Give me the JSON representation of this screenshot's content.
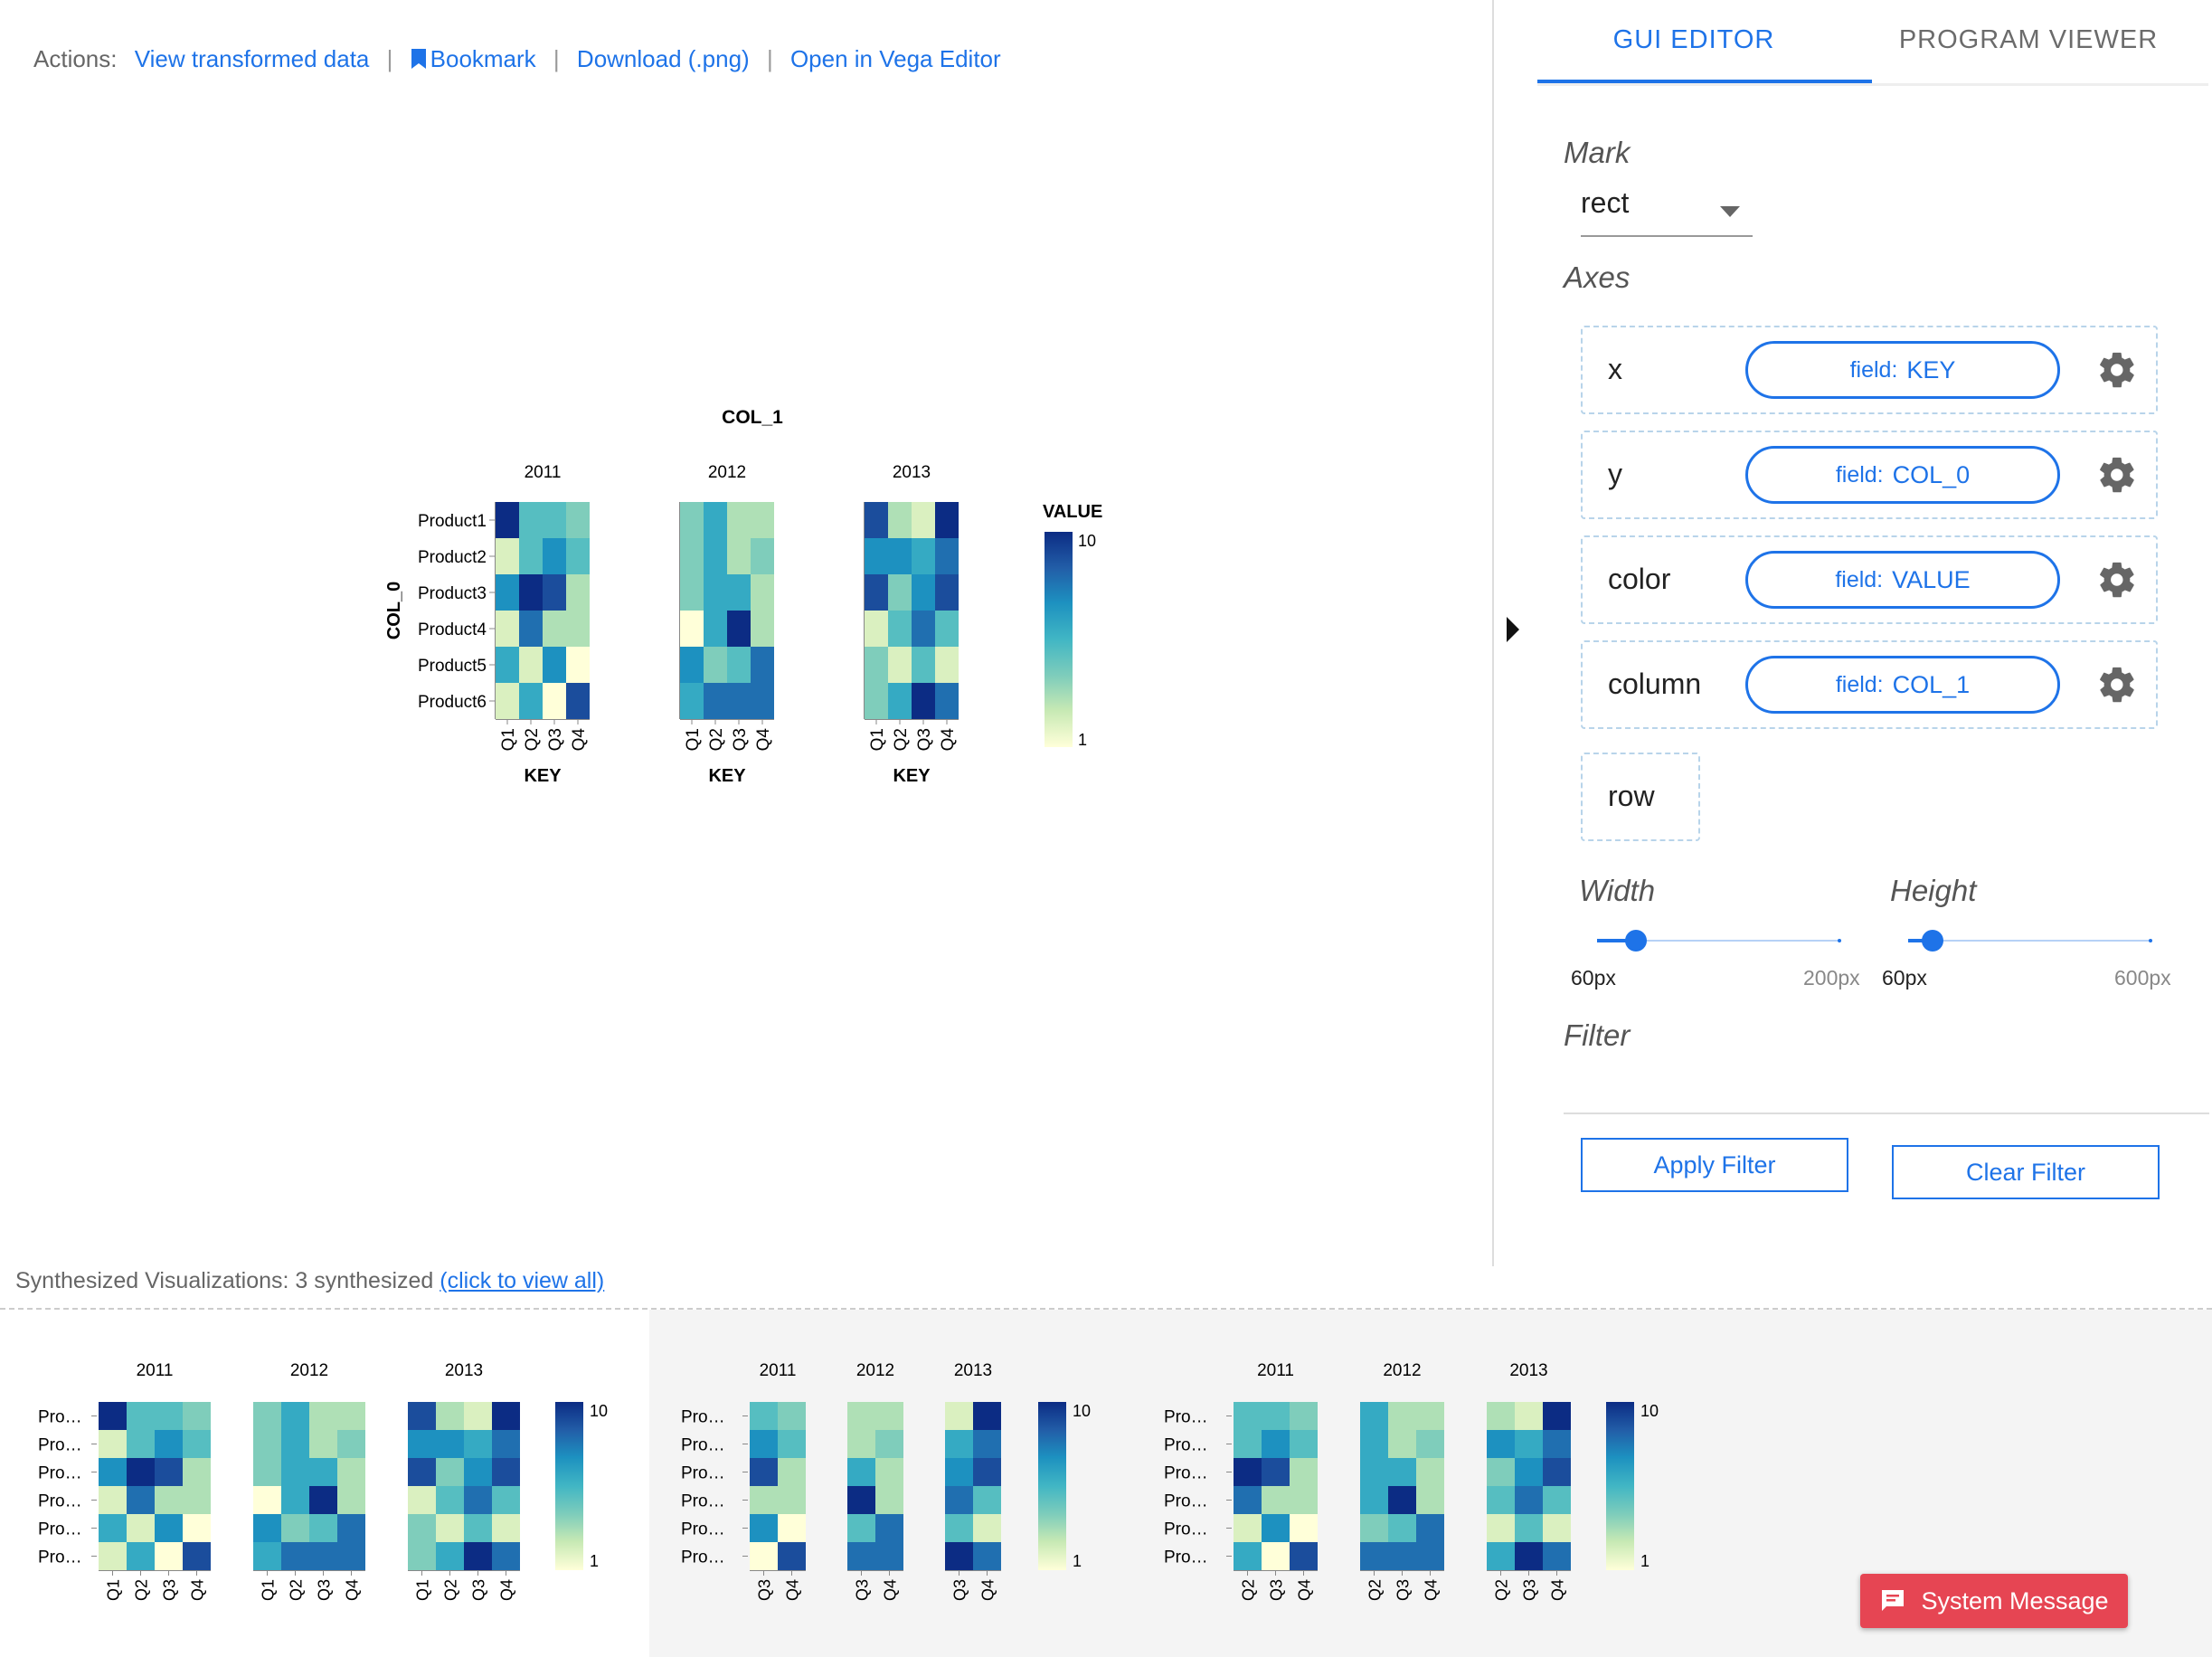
{
  "actions": {
    "prefix": "Actions:",
    "view_data": "View transformed data",
    "bookmark": "Bookmark",
    "download": "Download (.png)",
    "open_vega": "Open in Vega Editor",
    "separator": "|"
  },
  "chart_data": {
    "type": "heatmap",
    "title": "COL_1",
    "facets": [
      "2011",
      "2012",
      "2013"
    ],
    "x_field": "KEY",
    "y_field": "COL_0",
    "color_field": "VALUE",
    "x_categories": [
      "Q1",
      "Q2",
      "Q3",
      "Q4"
    ],
    "y_categories": [
      "Product1",
      "Product2",
      "Product3",
      "Product4",
      "Product5",
      "Product6"
    ],
    "color_range": [
      1,
      10
    ],
    "color_scheme": [
      "#ffffd9",
      "#c7e9b4",
      "#7fcdbb",
      "#41b6c4",
      "#1d91c0",
      "#225ea8",
      "#0c2c84"
    ],
    "values": {
      "2011": [
        [
          10,
          5,
          5,
          4
        ],
        [
          2,
          5,
          7,
          5
        ],
        [
          7,
          10,
          9,
          3
        ],
        [
          2,
          8,
          3,
          3
        ],
        [
          6,
          2,
          7,
          1
        ],
        [
          2,
          6,
          1,
          9
        ]
      ],
      "2012": [
        [
          4,
          6,
          3,
          3
        ],
        [
          4,
          6,
          3,
          4
        ],
        [
          4,
          6,
          6,
          3
        ],
        [
          1,
          6,
          10,
          3
        ],
        [
          7,
          4,
          5,
          8
        ],
        [
          6,
          8,
          8,
          8
        ]
      ],
      "2013": [
        [
          9,
          3,
          2,
          10
        ],
        [
          7,
          7,
          6,
          8
        ],
        [
          9,
          4,
          7,
          9
        ],
        [
          2,
          5,
          8,
          5
        ],
        [
          4,
          2,
          5,
          2
        ],
        [
          4,
          6,
          10,
          8
        ]
      ]
    },
    "legend_ticks": [
      "10",
      "1"
    ]
  },
  "panel": {
    "tab_gui": "GUI EDITOR",
    "tab_program": "PROGRAM VIEWER",
    "mark_label": "Mark",
    "mark_value": "rect",
    "axes_label": "Axes",
    "encodings": [
      {
        "channel": "x",
        "key": "field:",
        "value": "KEY"
      },
      {
        "channel": "y",
        "key": "field:",
        "value": "COL_0"
      },
      {
        "channel": "color",
        "key": "field:",
        "value": "VALUE"
      },
      {
        "channel": "column",
        "key": "field:",
        "value": "COL_1"
      }
    ],
    "row_label": "row",
    "width_label": "Width",
    "width_min": "60px",
    "width_max": "200px",
    "width_level": 0.16,
    "height_label": "Height",
    "height_min": "60px",
    "height_max": "600px",
    "height_level": 0.1,
    "filter_label": "Filter",
    "apply_filter": "Apply Filter",
    "clear_filter": "Clear Filter"
  },
  "gallery": {
    "heading": "Synthesized Visualizations: 3 synthesized",
    "view_all": "(click to view all)",
    "row_label": "Pro…",
    "thumbs": [
      {
        "cols": [
          "Q1",
          "Q2",
          "Q3",
          "Q4"
        ]
      },
      {
        "cols": [
          "Q3",
          "Q4"
        ]
      },
      {
        "cols": [
          "Q2",
          "Q3",
          "Q4"
        ]
      }
    ]
  },
  "system_message": "System Message",
  "colors": {
    "accent": "#1e73e8",
    "sysmsg": "#e64553"
  }
}
